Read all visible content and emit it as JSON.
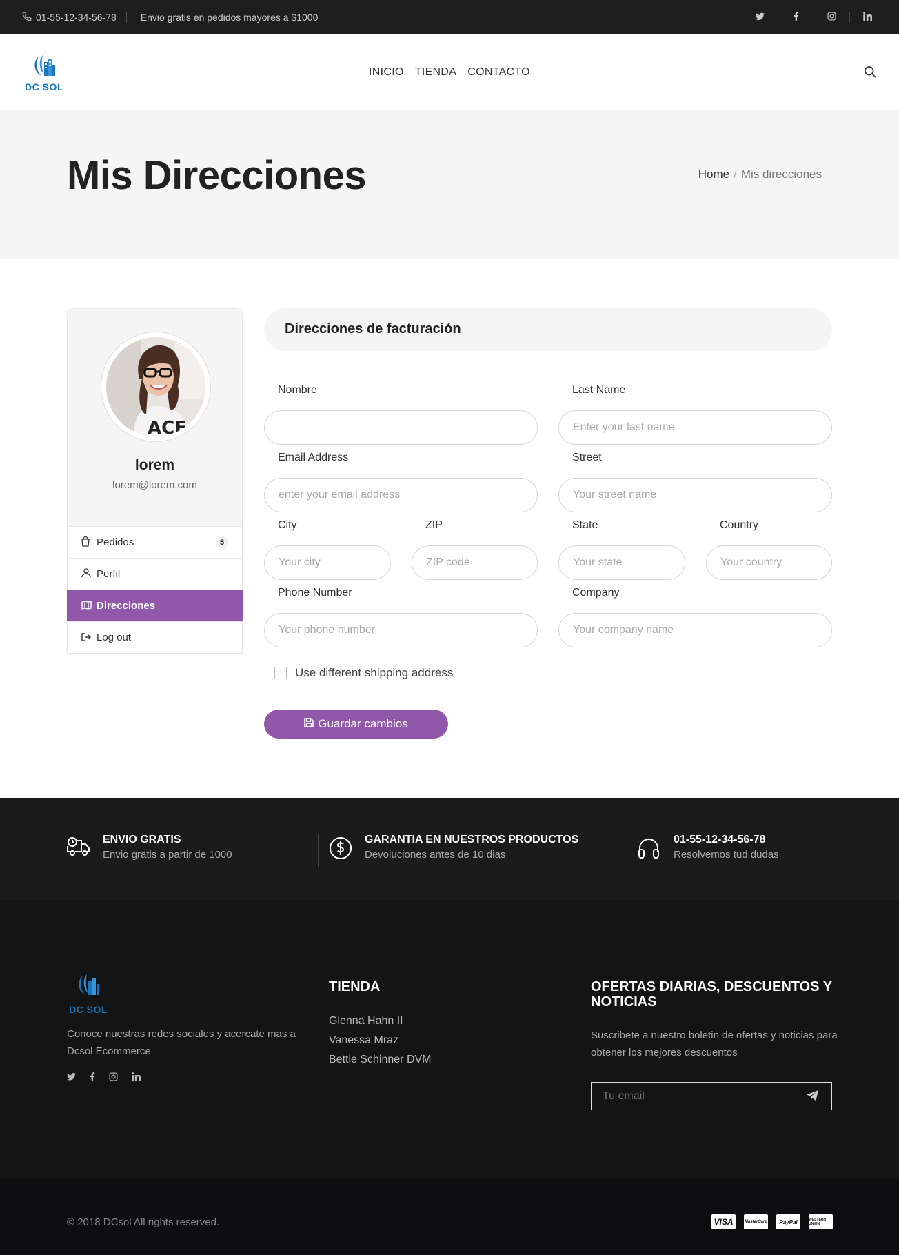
{
  "topbar": {
    "phone": "01-55-12-34-56-78",
    "shipping_note": "Envio gratis en pedidos mayores a $1000",
    "social": [
      "twitter-icon",
      "facebook-icon",
      "instagram-icon",
      "linkedin-icon"
    ]
  },
  "header": {
    "logo_text": "DC SOL",
    "nav": [
      "INICIO",
      "TIENDA",
      "CONTACTO"
    ]
  },
  "page": {
    "title": "Mis Direcciones",
    "breadcrumb_home": "Home",
    "breadcrumb_sep": "/",
    "breadcrumb_current": "Mis direcciones"
  },
  "sidebar": {
    "user_name": "lorem",
    "user_email": "lorem@lorem.com",
    "menu": [
      {
        "label": "Pedidos",
        "icon": "shopping-bag-icon",
        "badge": "5"
      },
      {
        "label": "Perfil",
        "icon": "user-icon"
      },
      {
        "label": "Direcciones",
        "icon": "map-icon",
        "active": true
      },
      {
        "label": "Log out",
        "icon": "sign-out-icon"
      }
    ]
  },
  "form": {
    "heading": "Direcciones de facturación",
    "fields": {
      "nombre": {
        "label": "Nombre",
        "placeholder": ""
      },
      "last_name": {
        "label": "Last Name",
        "placeholder": "Enter your last name"
      },
      "email": {
        "label": "Email Address",
        "placeholder": "enter your email address"
      },
      "street": {
        "label": "Street",
        "placeholder": "Your street name"
      },
      "city": {
        "label": "City",
        "placeholder": "Your city"
      },
      "zip": {
        "label": "ZIP",
        "placeholder": "ZIP code"
      },
      "state": {
        "label": "State",
        "placeholder": "Your state"
      },
      "country": {
        "label": "Country",
        "placeholder": "Your country"
      },
      "phone": {
        "label": "Phone Number",
        "placeholder": "Your phone number"
      },
      "company": {
        "label": "Company",
        "placeholder": "Your company name"
      }
    },
    "checkbox_label": "Use different shipping address",
    "save_label": "Guardar cambios"
  },
  "features": [
    {
      "title": "ENVIO GRATIS",
      "desc": "Envio gratis a partir de 1000",
      "icon": "delivery-truck-icon"
    },
    {
      "title": "GARANTIA EN NUESTROS PRODUCTOS",
      "desc": "Devoluciones antes de 10 dias",
      "icon": "dollar-circle-icon"
    },
    {
      "title": "01-55-12-34-56-78",
      "desc": "Resolvemos tud dudas",
      "icon": "headphones-icon"
    }
  ],
  "footer": {
    "logo_text": "DC SOL",
    "about": "Conoce nuestras redes sociales y acercate mas a Dcsol Ecommerce",
    "shop_title": "TIENDA",
    "shop_links": [
      "Glenna Hahn II",
      "Vanessa Mraz",
      "Bettie Schinner DVM"
    ],
    "news_title": "OFERTAS DIARIAS, DESCUENTOS Y NOTICIAS",
    "news_text": "Suscribete a nuestro boletin de ofertas y noticias para obtener los mejores descuentos",
    "email_placeholder": "Tu email",
    "copyright": "© 2018 DCsol All rights reserved.",
    "payments": [
      "VISA",
      "MasterCard",
      "PayPal",
      "WESTERN UNION"
    ]
  },
  "colors": {
    "accent": "#9157a8",
    "brand_blue": "#1b75bc",
    "dark": "#1e1e1e"
  }
}
